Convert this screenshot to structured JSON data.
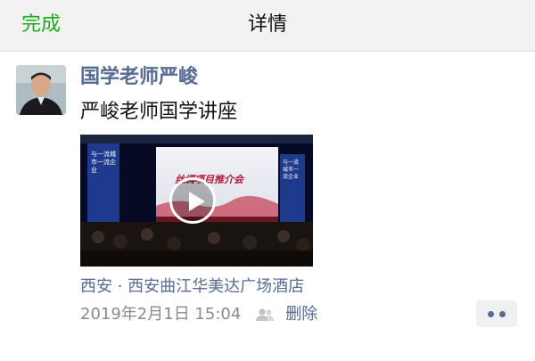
{
  "navbar": {
    "done_label": "完成",
    "title": "详情"
  },
  "post": {
    "author": "国学老师严峻",
    "text": "严峻老师国学讲座",
    "video": {
      "stage_title": "丝绸项目推介会",
      "banner_left": "与一流城市一流企业",
      "banner_right": "与一流城市一流企业"
    },
    "location": "西安 · 西安曲江华美达广场酒店",
    "timestamp": "2019年2月1日 15:04",
    "delete_label": "删除"
  },
  "colors": {
    "accent_green": "#1aad19",
    "link_blue": "#576b95",
    "meta_gray": "#8a8a8a"
  },
  "icons": {
    "visibility": "people-icon",
    "more": "more-dots-icon",
    "play": "play-icon"
  }
}
